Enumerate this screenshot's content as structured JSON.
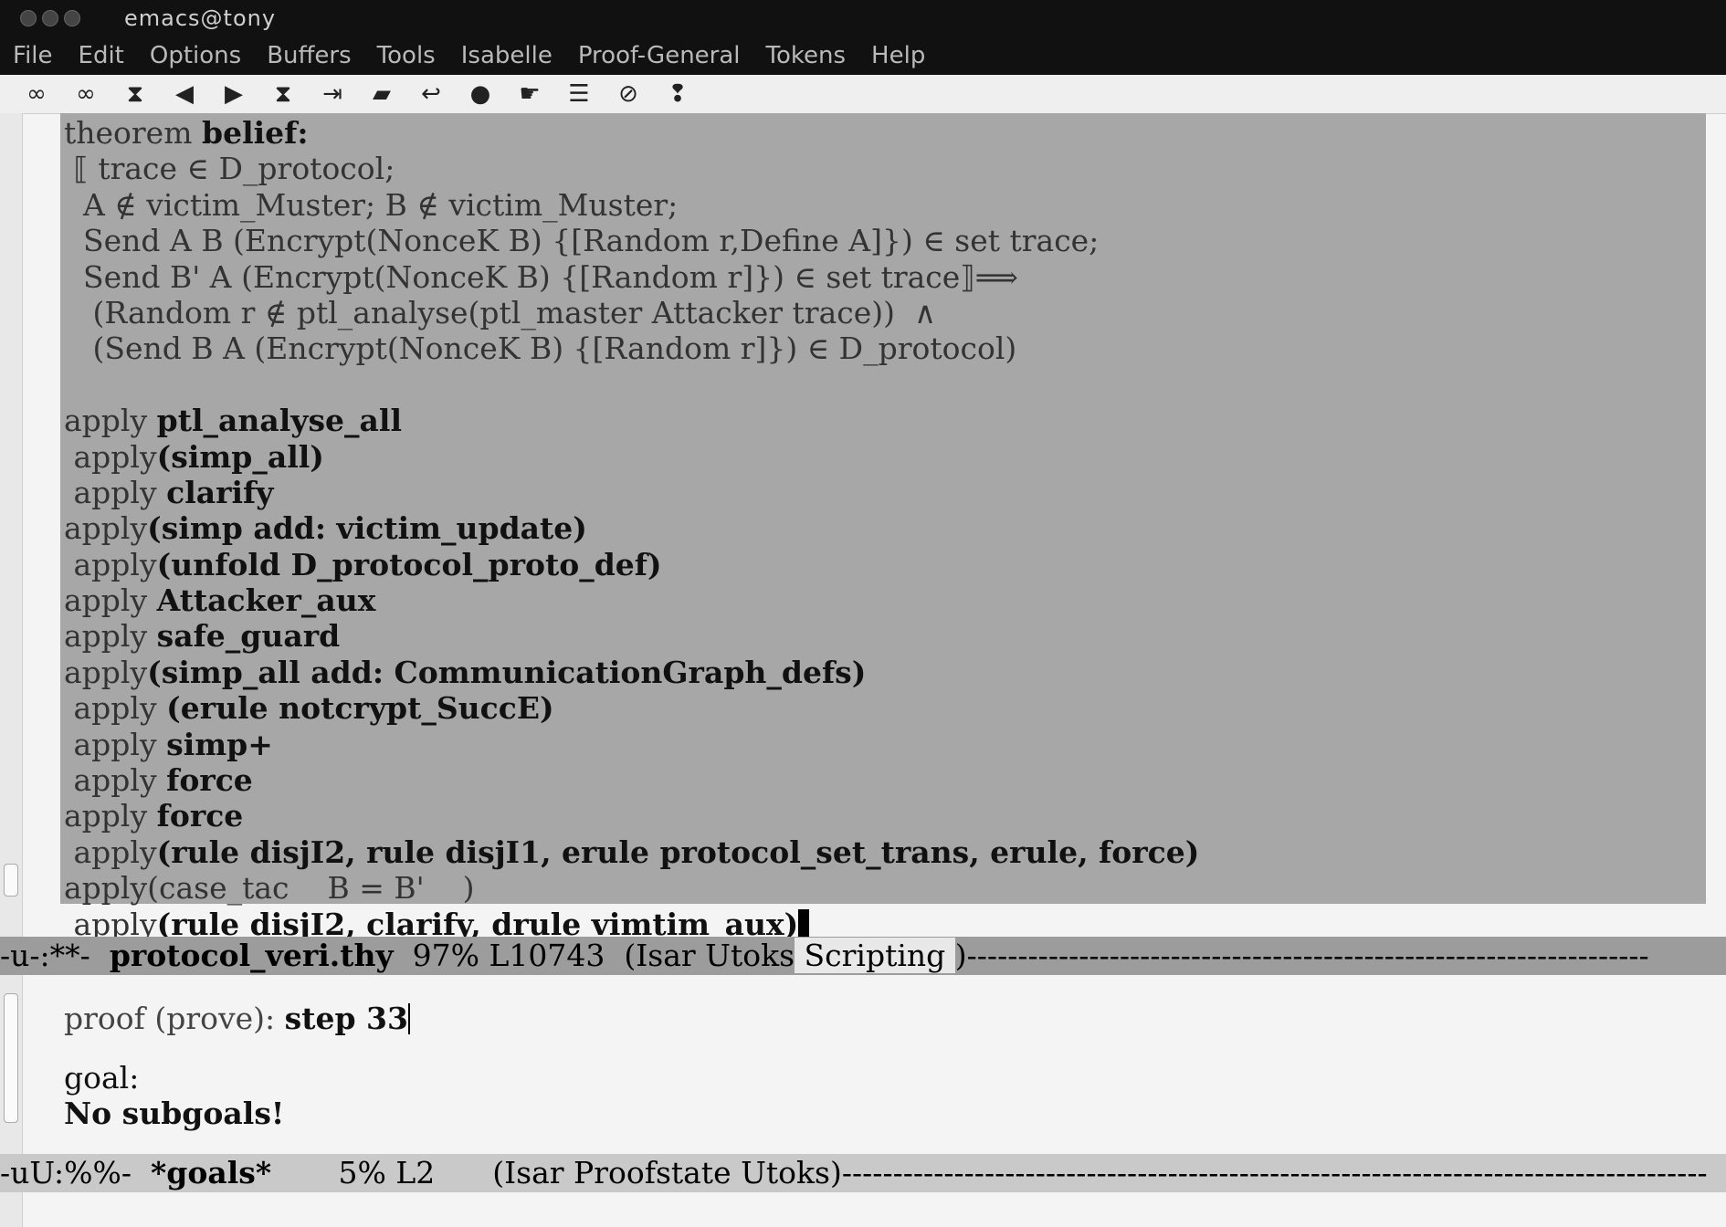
{
  "window": {
    "title": "emacs@tony"
  },
  "menubar": {
    "items": [
      "File",
      "Edit",
      "Options",
      "Buffers",
      "Tools",
      "Isabelle",
      "Proof-General",
      "Tokens",
      "Help"
    ]
  },
  "toolbar": {
    "icons": [
      {
        "name": "retract-icon",
        "glyph": "∞"
      },
      {
        "name": "undo-icon",
        "glyph": "∞"
      },
      {
        "name": "goal-icon",
        "glyph": "⧗"
      },
      {
        "name": "undo-step-icon",
        "glyph": "◀"
      },
      {
        "name": "next-step-icon",
        "glyph": "▶"
      },
      {
        "name": "use-icon",
        "glyph": "⧗"
      },
      {
        "name": "goto-icon",
        "glyph": "⇥"
      },
      {
        "name": "qed-icon",
        "glyph": "▰"
      },
      {
        "name": "state-icon",
        "glyph": "↩"
      },
      {
        "name": "context-icon",
        "glyph": "●"
      },
      {
        "name": "find-icon",
        "glyph": "☛"
      },
      {
        "name": "command-icon",
        "glyph": "☰"
      },
      {
        "name": "interrupt-icon",
        "glyph": "⊘"
      },
      {
        "name": "info-icon",
        "glyph": "❢"
      }
    ]
  },
  "editor": {
    "lines": [
      {
        "indent": 0,
        "pre": "theorem ",
        "bold": "belief:"
      },
      {
        "indent": 1,
        "pre": "⟦ trace ∈ D_protocol;",
        "bold": ""
      },
      {
        "indent": 2,
        "pre": "A ∉ victim_Muster; B ∉ victim_Muster;",
        "bold": ""
      },
      {
        "indent": 1,
        "pre": " Send A B (Encrypt(NonceK B) {[Random r,Define A]}) ∈ set trace;",
        "bold": ""
      },
      {
        "indent": 1,
        "pre": " Send B' A (Encrypt(NonceK B) {[Random r]}) ∈ set trace⟧⟹",
        "bold": ""
      },
      {
        "indent": 2,
        "pre": " (Random r ∉ ptl_analyse(ptl_master Attacker trace))  ∧",
        "bold": ""
      },
      {
        "indent": 2,
        "pre": " (Send B A (Encrypt(NonceK B) {[Random r]}) ∈ D_protocol)",
        "bold": ""
      },
      {
        "indent": 0,
        "pre": "",
        "bold": ""
      },
      {
        "indent": 0,
        "pre": "apply ",
        "bold": "ptl_analyse_all"
      },
      {
        "indent": 1,
        "pre": "apply",
        "bold": "(simp_all)"
      },
      {
        "indent": 1,
        "pre": "apply ",
        "bold": "clarify"
      },
      {
        "indent": 0,
        "pre": "apply",
        "bold": "(simp add: victim_update)"
      },
      {
        "indent": 1,
        "pre": "apply",
        "bold": "(unfold D_protocol_proto_def)"
      },
      {
        "indent": 0,
        "pre": "apply ",
        "bold": "Attacker_aux"
      },
      {
        "indent": 0,
        "pre": "apply ",
        "bold": "safe_guard"
      },
      {
        "indent": 0,
        "pre": "apply",
        "bold": "(simp_all add: CommunicationGraph_defs)"
      },
      {
        "indent": 1,
        "pre": "apply ",
        "bold": "(erule notcrypt_SuccE)"
      },
      {
        "indent": 1,
        "pre": "apply ",
        "bold": "simp+"
      },
      {
        "indent": 1,
        "pre": "apply ",
        "bold": "force"
      },
      {
        "indent": 0,
        "pre": "apply ",
        "bold": "force"
      },
      {
        "indent": 1,
        "pre": "apply",
        "bold": "(rule disjI2, rule disjI1, erule protocol_set_trans, erule, force)"
      },
      {
        "indent": 0,
        "pre": "apply(case_tac    B = B'    )",
        "bold": ""
      },
      {
        "indent": 1,
        "pre": "apply",
        "bold": "(rule disjI2, clarify, drule vimtim_aux)"
      }
    ]
  },
  "modeline_main": {
    "prefix": "-u-:**-  ",
    "buffer": "protocol_veri.thy",
    "position": "  97% L10743  (Isar ",
    "mode_hl_a": "Utoks",
    "mode_hl_b": " Scripting ",
    "suffix": ")-------------------------------------------------------------------"
  },
  "goals": {
    "proof_label": "proof (prove): ",
    "proof_step": "step 33",
    "goal_label": "goal:",
    "goal_text": "No subgoals!"
  },
  "modeline_goals": {
    "prefix": "-uU:%%-  ",
    "buffer": "*goals*",
    "position": "       5% L2      (Isar Proofstate Utoks)",
    "suffix": "-------------------------------------------------------------------------------------"
  }
}
